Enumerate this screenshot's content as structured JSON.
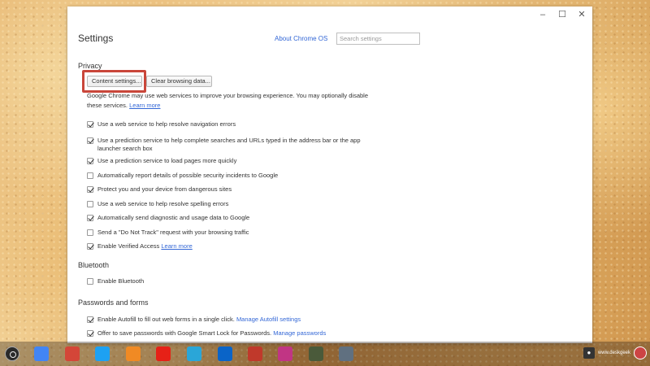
{
  "window": {
    "controls": {
      "minimize": "–",
      "maximize": "☐",
      "close": "✕"
    }
  },
  "header": {
    "title": "Settings",
    "about_link": "About Chrome OS",
    "search_placeholder": "Search settings"
  },
  "privacy": {
    "title": "Privacy",
    "content_settings_button": "Content settings...",
    "clear_data_button": "Clear browsing data...",
    "description": "Google Chrome may use web services to improve your browsing experience. You may optionally disable these services.",
    "learn_more": "Learn more",
    "options": [
      {
        "label": "Use a web service to help resolve navigation errors",
        "checked": true
      },
      {
        "label": "Use a prediction service to help complete searches and URLs typed in the address bar or the app launcher search box",
        "checked": true
      },
      {
        "label": "Use a prediction service to load pages more quickly",
        "checked": true
      },
      {
        "label": "Automatically report details of possible security incidents to Google",
        "checked": false
      },
      {
        "label": "Protect you and your device from dangerous sites",
        "checked": true
      },
      {
        "label": "Use a web service to help resolve spelling errors",
        "checked": false
      },
      {
        "label": "Automatically send diagnostic and usage data to Google",
        "checked": true
      },
      {
        "label": "Send a \"Do Not Track\" request with your browsing traffic",
        "checked": false
      },
      {
        "label": "Enable Verified Access",
        "checked": true,
        "link": "Learn more"
      }
    ]
  },
  "bluetooth": {
    "title": "Bluetooth",
    "enable_label": "Enable Bluetooth",
    "checked": false
  },
  "passwords": {
    "title": "Passwords and forms",
    "autofill_label": "Enable Autofill to fill out web forms in a single click.",
    "autofill_link": "Manage Autofill settings",
    "autofill_checked": true,
    "smartlock_label": "Offer to save passwords with Google Smart Lock for Passwords.",
    "smartlock_link": "Manage passwords",
    "smartlock_checked": true
  },
  "shelf": {
    "apps": [
      {
        "name": "chrome-icon",
        "color": "#4285f4"
      },
      {
        "name": "gmail-icon",
        "color": "#d44638"
      },
      {
        "name": "twitter-icon",
        "color": "#1da1f2"
      },
      {
        "name": "pocket-icon",
        "color": "#f08a24"
      },
      {
        "name": "youtube-icon",
        "color": "#e62117"
      },
      {
        "name": "camera-icon",
        "color": "#2aa6d8"
      },
      {
        "name": "onedrive-icon",
        "color": "#0a64c8"
      },
      {
        "name": "game-icon",
        "color": "#c0392b"
      },
      {
        "name": "instagram-icon",
        "color": "#c13584"
      },
      {
        "name": "android-app-icon",
        "color": "#4a5a3a"
      },
      {
        "name": "settings-app-icon",
        "color": "#607080"
      }
    ],
    "tray_status": "www.deskgeek"
  }
}
